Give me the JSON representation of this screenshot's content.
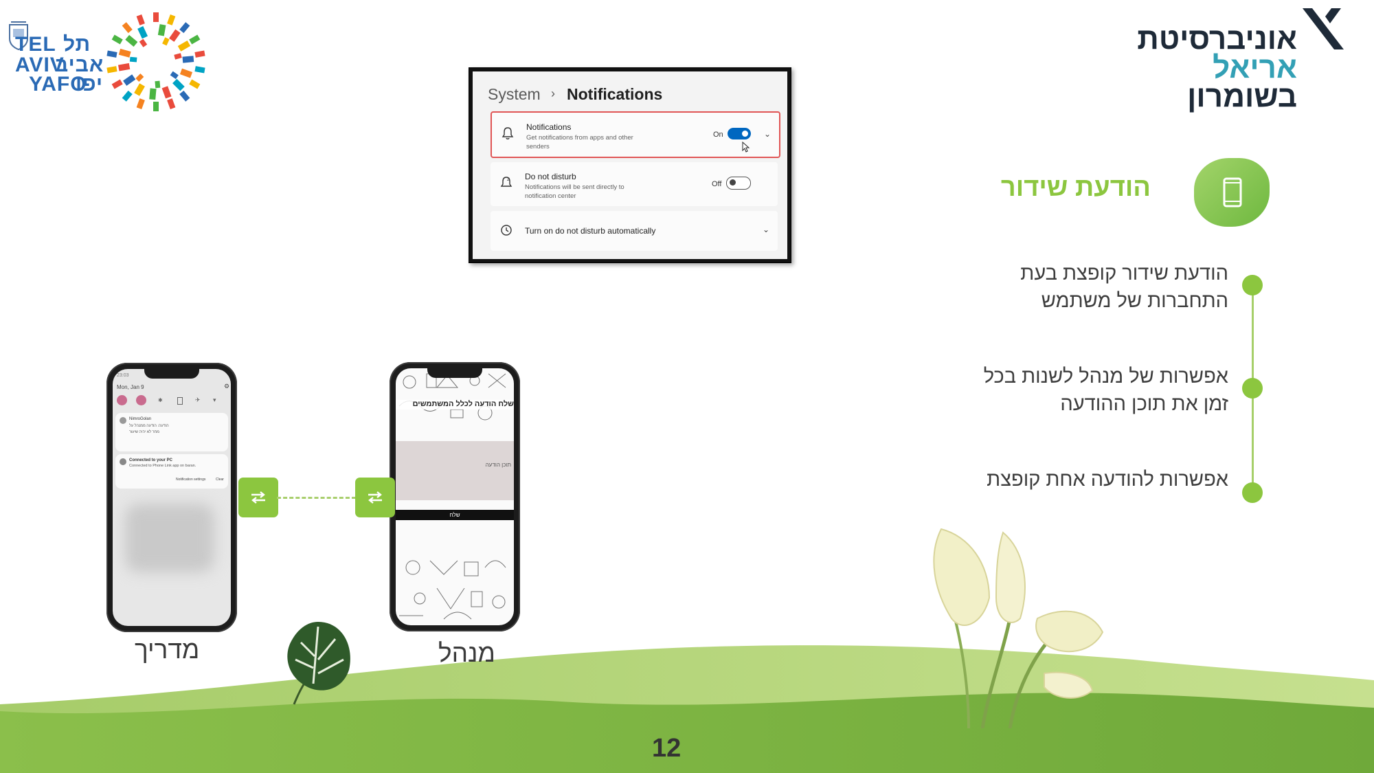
{
  "logos": {
    "tel_aviv": {
      "hebrew": [
        "תל",
        "אביב",
        "יפו"
      ],
      "latin": [
        "TEL",
        "AVIV",
        "YAFO"
      ]
    },
    "ariel": {
      "lines": [
        "אוניברסיטת",
        "אריאל",
        "בשומרון"
      ]
    }
  },
  "slide": {
    "title": "הודעת שידור",
    "title_icon": "smartphone-icon",
    "bullets": [
      "הודעת שידור קופצת בעת התחברות של משתמש",
      "אפשרות של מנהל לשנות בכל זמן את תוכן ההודעה",
      "אפשרות להודעה אחת קופצת"
    ],
    "page_number": "12"
  },
  "settings_screenshot": {
    "breadcrumb_parent": "System",
    "breadcrumb_separator": "›",
    "breadcrumb_current": "Notifications",
    "rows": [
      {
        "title": "Notifications",
        "description": "Get notifications from apps and other senders",
        "state": "On",
        "icon": "bell-icon"
      },
      {
        "title": "Do not disturb",
        "description": "Notifications will be sent directly to notification center",
        "state": "Off",
        "icon": "do-not-disturb-icon"
      },
      {
        "title": "Turn on do not disturb automatically",
        "icon": "clock-icon"
      }
    ]
  },
  "phones": {
    "guide": {
      "label": "מדריך",
      "status_time": "23:03",
      "date": "Mon, Jan 9",
      "notification_app": "NimroGolan",
      "notification_lines": [
        "הודעה: הודעה ממנהל על",
        "מחר לא יהיה שיעור"
      ],
      "pc_title": "Connected to your PC",
      "pc_subtitle": "Connected to Phone Link app on baran.",
      "notification_settings": "Notification settings",
      "clear": "Clear"
    },
    "admin": {
      "label": "מנהל",
      "header": "שלח הודעה לכלל המשתמשים",
      "placeholder": "תוכן הודעה",
      "send_button": "שלח"
    }
  },
  "colors": {
    "accent_green": "#8cc63f",
    "ariel_dark": "#1e2a38",
    "ariel_teal": "#33a0b5",
    "tlv_blue": "#2a6ab5",
    "windows_blue": "#0067c0"
  }
}
